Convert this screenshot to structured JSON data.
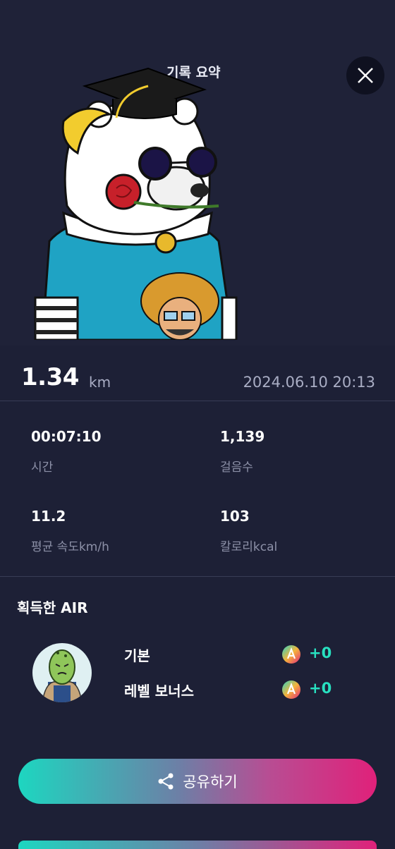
{
  "header": {
    "title": "기록 요약"
  },
  "summary": {
    "distance": "1.34",
    "distance_unit": "km",
    "datetime": "2024.06.10  20:13"
  },
  "stats": [
    {
      "value": "00:07:10",
      "label": "시간"
    },
    {
      "value": "1,139",
      "label": "걸음수"
    },
    {
      "value": "11.2",
      "label": "평균 속도km/h"
    },
    {
      "value": "103",
      "label": "칼로리kcal"
    }
  ],
  "air": {
    "title": "획득한 AIR",
    "rewards": [
      {
        "label": "기본",
        "value": "+0"
      },
      {
        "label": "레벨 보너스",
        "value": "+0"
      }
    ]
  },
  "share": {
    "label": "공유하기"
  },
  "colors": {
    "background": "#1d2036",
    "accent_teal": "#28e0c0",
    "accent_pink": "#e0217a"
  },
  "icons": {
    "close": "close-icon",
    "share": "share-icon",
    "coin": "air-coin-icon"
  }
}
